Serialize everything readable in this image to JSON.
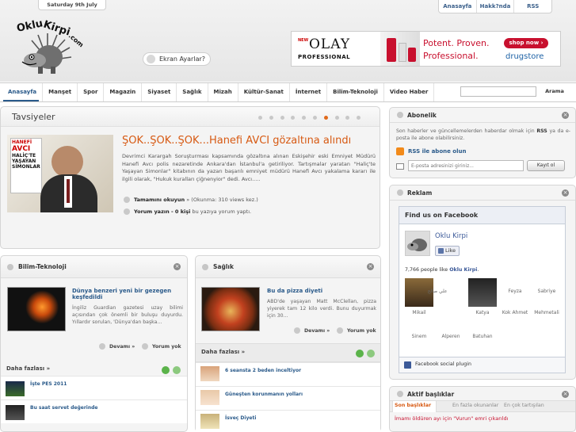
{
  "header": {
    "date": "Saturday 9th July",
    "top_links": [
      "Anasayfa",
      "Hakk?nda",
      "RSS"
    ],
    "logo_text": "OkluKirpi.com",
    "screen_settings": "Ekran Ayarlar?"
  },
  "ad": {
    "new_label": "NEW",
    "brand": "OLAY",
    "brand_sub": "PROFESSIONAL",
    "slogan_1": "Potent. Proven.",
    "slogan_2": "Professional.",
    "cta": "shop now ›",
    "store": "drugstore"
  },
  "nav": {
    "items": [
      "Anasayfa",
      "Manşet",
      "Spor",
      "Magazin",
      "Siyaset",
      "Sağlık",
      "Mizah",
      "Kültür-Sanat",
      "İnternet",
      "Bilim-Teknoloji",
      "Video Haber"
    ],
    "active_index": 0,
    "search_button": "Arama"
  },
  "tavsiyeler": {
    "title": "Tavsiyeler",
    "dots_count": 10,
    "active_dot": 6,
    "image_caption": [
      "HANEFİ",
      "AVCI",
      "HALİÇ'TE",
      "YAŞAYAN",
      "SİMONLAR"
    ],
    "headline": "ŞOK..ŞOK..ŞOK...Hanefi AVCI gözaltına alındı",
    "body": "Devrimci Karargah Soruşturması kapsamında gözaltına alınan Eskişehir eski Emniyet Müdürü Hanefi Avcı polis nezaretinde Ankara'dan İstanbul'a getiriliyor. Tartışmalar yaratan \"Haliç'te Yaşayan Simonlar\" kitabının da yazarı başarılı emniyet müdürü Hanefi Avcı yakalama kararı ile ilgili olarak, \"Hukuk kuralları çiğnenyior\" dedi. Avcı.....",
    "read_more": "Tamamını okuyun",
    "read_count": "» (Okunma: 310 views kez.)",
    "comment_prefix": "Yorum yazın - 0 kişi",
    "comment_suffix": "bu yazıya yorum yaptı."
  },
  "bilim": {
    "title": "Bilim-Teknoloji",
    "article_title": "Dünya benzeri yeni bir gezegen keşfedildi",
    "article_body": "İngiliz Guardian gazetesi uzay bilimi açısından çok önemli bir buluşu duyurdu. Yıllardır sorulan, 'Dünya'dan başka...",
    "devami": "Devamı",
    "yorum": "Yorum yok",
    "daha": "Daha fazlası »",
    "list": [
      "İşte PES 2011",
      "Bu saat servet değerinde"
    ]
  },
  "saglik": {
    "title": "Sağlık",
    "article_title": "Bu da pizza diyeti",
    "article_body": "ABD'de yaşayan Matt McClellan, pizza yiyerek tam 12 kilo verdi. Bunu duyurmak için 30...",
    "devami": "Devamı",
    "yorum": "Yorum yok",
    "daha": "Daha fazlası »",
    "list": [
      "6 seansta 2 beden inceltiyor",
      "Güneşten korunmanın yolları",
      "İsveç Diyeti"
    ]
  },
  "abonelik": {
    "title": "Abonelik",
    "text_1": "Son haberler ve güncellemelerden haberdar olmak için",
    "text_rss": "RSS",
    "text_2": "ya da e-posta ile abone olabilirsiniz.",
    "rss_link": "RSS ile abone olun",
    "email_placeholder": "E-posta adresinizi giriniz...",
    "submit": "Kayıt ol"
  },
  "reklam": {
    "title": "Reklam",
    "fb_header": "Find us on Facebook",
    "page_name": "Oklu Kirpi",
    "like": "Like",
    "likes_prefix": "7,766 people like",
    "likes_name": "Oklu Kirpi",
    "likes_suffix": ".",
    "names_row1": [
      "Mikail",
      "Katya",
      "Feyza",
      "Sabriye"
    ],
    "names_row1_extra": [
      "علي صالح",
      "Kok Ahmet",
      "Mehmetali"
    ],
    "names_row2": [
      "Sinem",
      "Alperen",
      "Batuhan"
    ],
    "plugin": "Facebook social plugin"
  },
  "aktif": {
    "title": "Aktif başlıklar",
    "tabs": [
      "Son başlıklar",
      "En fazla okunanlar",
      "En çok tartışılan"
    ],
    "items": [
      "İmamı öldüren ayı için \"Vurun\" emri çıkarıldı"
    ]
  },
  "colors": {
    "accent": "#d75a13",
    "link": "#2a5a8a"
  }
}
